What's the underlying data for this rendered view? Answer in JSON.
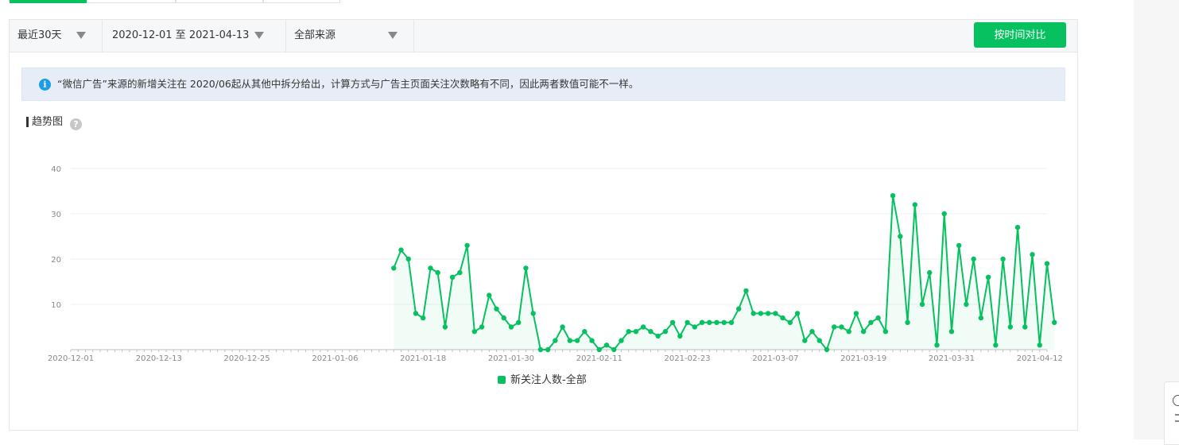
{
  "filters": {
    "range": "最近30天",
    "dates": "2020-12-01 至 2021-04-13",
    "source": "全部来源"
  },
  "compare_button": "按时间对比",
  "notice": "“微信广告”来源的新增关注在 2020/06起从其他中拆分给出，计算方式与广告主页面关注次数略有不同，因此两者数值可能不一样。",
  "section_title": "趋势图",
  "help_glyph": "?",
  "info_glyph": "i",
  "colors": {
    "accent": "#07c160",
    "notice_bg": "#e6edf6",
    "info": "#1a9ce8"
  },
  "chart_data": {
    "type": "area",
    "title": "",
    "xlabel": "",
    "ylabel": "",
    "ylim": [
      0,
      40
    ],
    "yticks": [
      10,
      20,
      30,
      40
    ],
    "x_start": "2020-12-01",
    "x_end": "2021-04-13",
    "xtick_labels": [
      "2020-12-01",
      "2020-12-13",
      "2020-12-25",
      "2021-01-06",
      "2021-01-18",
      "2021-01-30",
      "2021-02-11",
      "2021-02-23",
      "2021-03-07",
      "2021-03-19",
      "2021-03-31",
      "2021-04-12"
    ],
    "grid": true,
    "legend_position": "bottom-center",
    "series": [
      {
        "name": "新关注人数-全部",
        "color": "#07c160",
        "start_date": "2021-01-14",
        "values": [
          18,
          22,
          20,
          8,
          7,
          18,
          17,
          5,
          16,
          17,
          23,
          4,
          5,
          12,
          9,
          7,
          5,
          6,
          18,
          8,
          0,
          0,
          2,
          5,
          2,
          2,
          4,
          2,
          0,
          1,
          0,
          2,
          4,
          4,
          5,
          4,
          3,
          4,
          6,
          3,
          6,
          5,
          6,
          6,
          6,
          6,
          6,
          9,
          13,
          8,
          8,
          8,
          8,
          7,
          6,
          8,
          2,
          4,
          2,
          0,
          5,
          5,
          4,
          8,
          4,
          6,
          7,
          4,
          34,
          25,
          6,
          32,
          10,
          17,
          1,
          30,
          4,
          23,
          10,
          20,
          7,
          16,
          1,
          20,
          5,
          27,
          5,
          21,
          1,
          19,
          6
        ]
      }
    ]
  }
}
